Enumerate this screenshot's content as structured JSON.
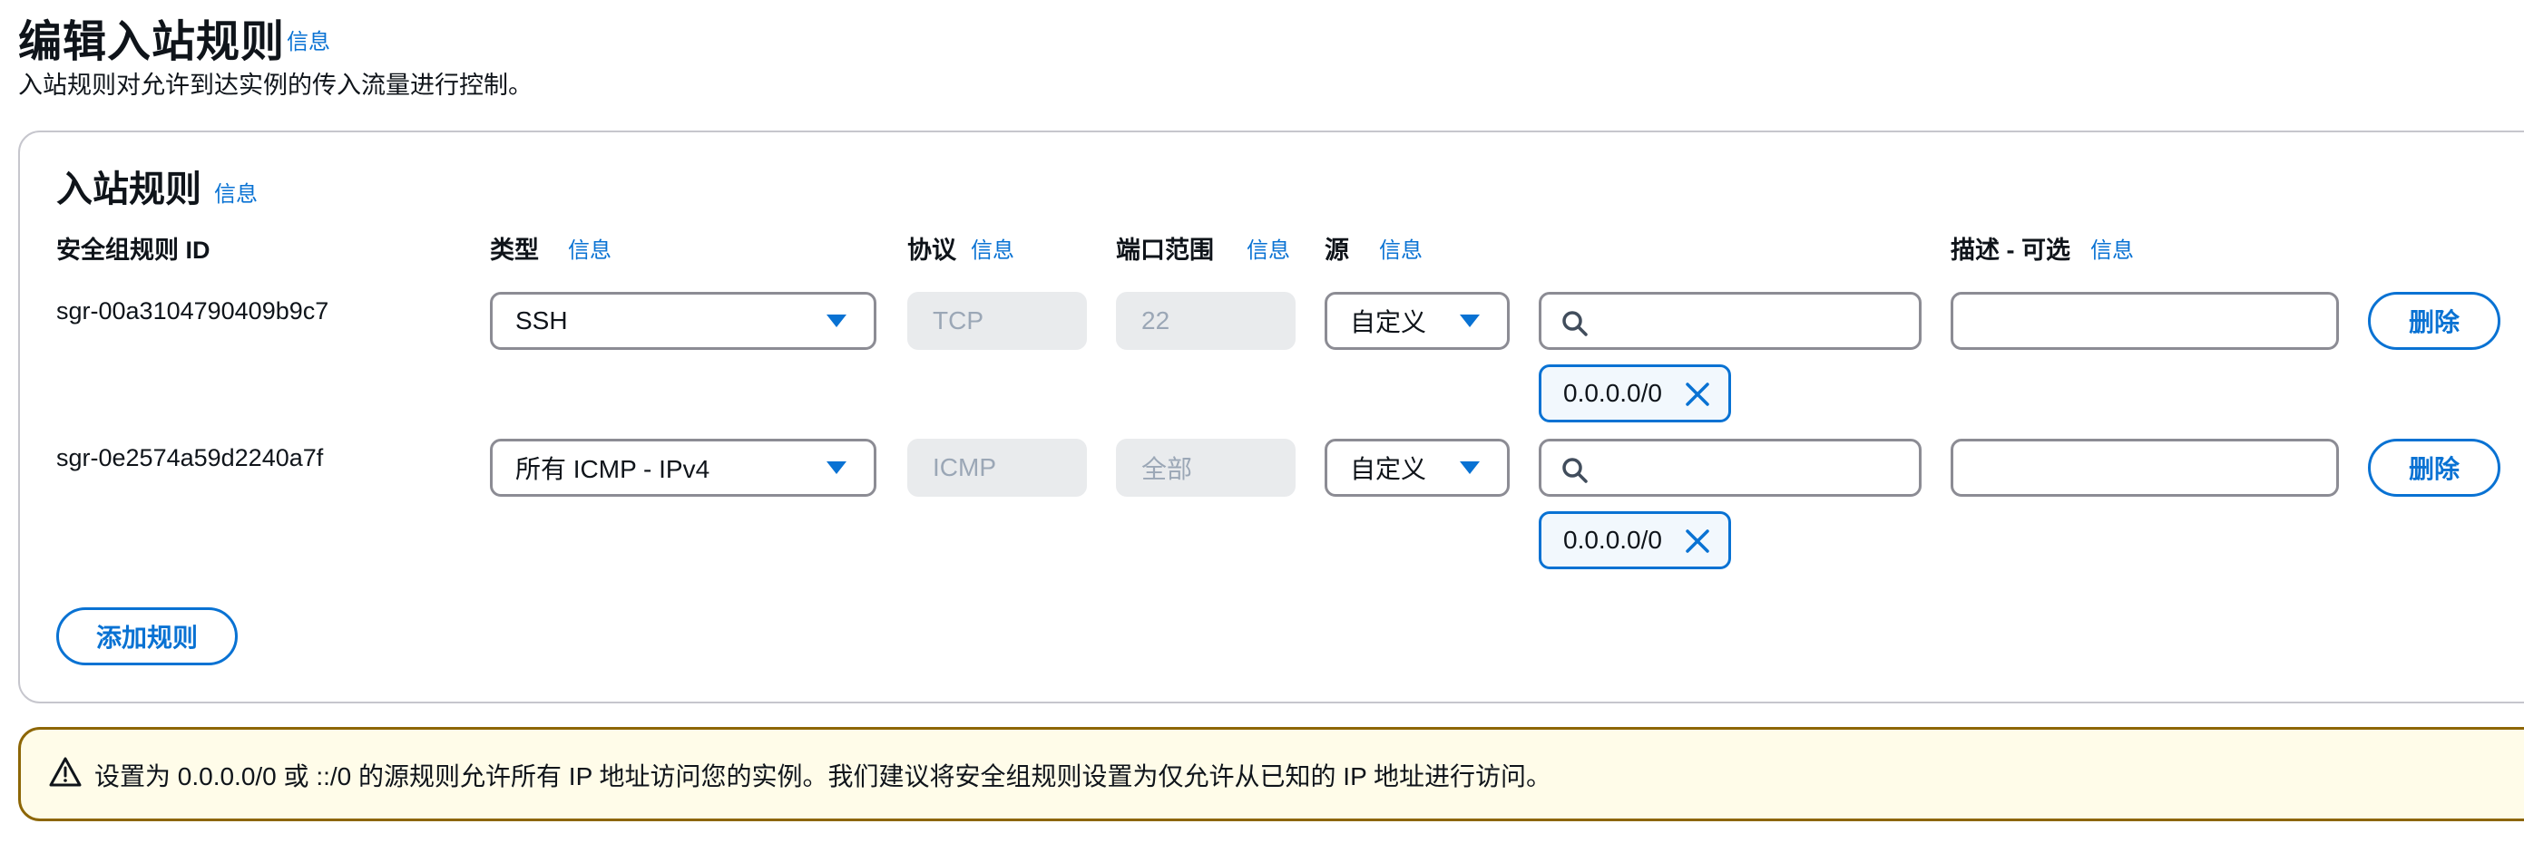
{
  "header": {
    "title": "编辑入站规则",
    "title_info": "信息",
    "description": "入站规则对允许到达实例的传入流量进行控制。"
  },
  "panel": {
    "title": "入站规则",
    "title_info": "信息",
    "columns": {
      "rule_id": "安全组规则 ID",
      "type": "类型",
      "type_info": "信息",
      "protocol": "协议",
      "protocol_info": "信息",
      "port_range": "端口范围",
      "port_range_info": "信息",
      "source": "源",
      "source_info": "信息",
      "description": "描述 - 可选",
      "description_info": "信息"
    },
    "rules": [
      {
        "id": "sgr-00a3104790409b9c7",
        "type": "SSH",
        "protocol": "TCP",
        "port_range": "22",
        "source_type": "自定义",
        "source_search": "",
        "source_token": "0.0.0.0/0",
        "description": "",
        "delete_label": "删除"
      },
      {
        "id": "sgr-0e2574a59d2240a7f",
        "type": "所有 ICMP - IPv4",
        "protocol": "ICMP",
        "port_range": "全部",
        "source_type": "自定义",
        "source_search": "",
        "source_token": "0.0.0.0/0",
        "description": "",
        "delete_label": "删除"
      }
    ],
    "add_rule_label": "添加规则"
  },
  "warning": {
    "text": "设置为 0.0.0.0/0 或 ::/0 的源规则允许所有 IP 地址访问您的实例。我们建议将安全组规则设置为仅允许从已知的 IP 地址进行访问。"
  },
  "colors": {
    "accent": "#0972d3",
    "warning_border": "#8d6605",
    "warning_bg": "#fffce9",
    "disabled_bg": "#e9ebed"
  }
}
